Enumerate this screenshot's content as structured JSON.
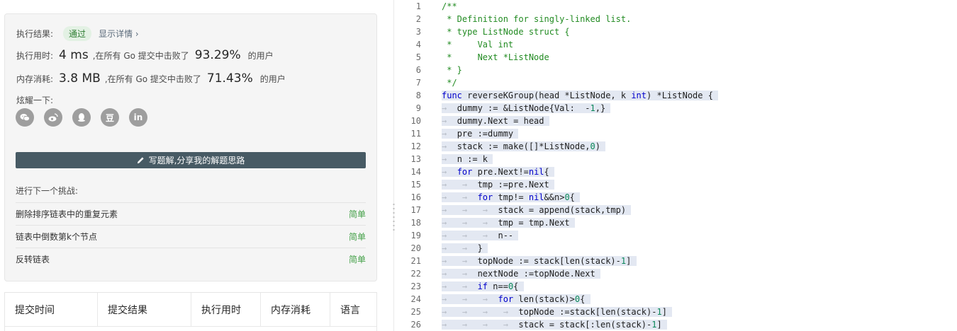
{
  "result": {
    "exec_label": "执行结果:",
    "status": "通过",
    "detail_link": "显示详情 ›",
    "time_label": "执行用时:",
    "time_value": "4 ms",
    "time_mid": ",在所有 Go 提交中击败了",
    "time_pct": "93.29%",
    "users_suffix": "的用户",
    "mem_label": "内存消耗:",
    "mem_value": "3.8 MB",
    "mem_mid": ",在所有 Go 提交中击败了",
    "mem_pct": "71.43%",
    "share_label": "炫耀一下:",
    "share_icons": [
      "wechat-icon",
      "weibo-icon",
      "qq-icon",
      "douban-icon",
      "linkedin-icon"
    ],
    "douban_glyph": "豆",
    "linkedin_glyph": "in",
    "write_button": "写题解,分享我的解题思路"
  },
  "next": {
    "title": "进行下一个挑战:",
    "items": [
      {
        "name": "删除排序链表中的重复元素",
        "difficulty": "简单"
      },
      {
        "name": "链表中倒数第k个节点",
        "difficulty": "简单"
      },
      {
        "name": "反转链表",
        "difficulty": "简单"
      }
    ]
  },
  "submissions_table": {
    "headers": [
      "提交时间",
      "提交结果",
      "执行用时",
      "内存消耗",
      "语言"
    ]
  },
  "colors": {
    "accent_dark": "#475a64",
    "success_green": "#43a047",
    "comment_green": "#228b22",
    "keyword_blue": "#0000cc",
    "highlight": "#e3e8f2"
  },
  "editor": {
    "lines": [
      [
        [
          "/**",
          "cm"
        ]
      ],
      [
        [
          " * Definition for singly-linked list.",
          "cm"
        ]
      ],
      [
        [
          " * type ListNode struct {",
          "cm"
        ]
      ],
      [
        [
          " *     Val int",
          "cm"
        ]
      ],
      [
        [
          " *     Next *ListNode",
          "cm"
        ]
      ],
      [
        [
          " * }",
          "cm"
        ]
      ],
      [
        [
          " */",
          "cm"
        ]
      ],
      [
        [
          "func",
          "kw"
        ],
        [
          " reverseKGroup(head *ListNode, k ",
          ""
        ],
        [
          "int",
          "kw"
        ],
        [
          ") *ListNode { ",
          ""
        ]
      ],
      [
        [
          "→  ",
          "ind"
        ],
        [
          "dummy := &ListNode{Val:  -",
          ""
        ],
        [
          "1",
          "num"
        ],
        [
          ",} ",
          ""
        ]
      ],
      [
        [
          "→  ",
          "ind"
        ],
        [
          "dummy.Next = head ",
          ""
        ]
      ],
      [
        [
          "→  ",
          "ind"
        ],
        [
          "pre :=dummy ",
          ""
        ]
      ],
      [
        [
          "→  ",
          "ind"
        ],
        [
          "stack := make([]*ListNode,",
          ""
        ],
        [
          "0",
          "num"
        ],
        [
          ") ",
          ""
        ]
      ],
      [
        [
          "→  ",
          "ind"
        ],
        [
          "n := k ",
          ""
        ]
      ],
      [
        [
          "→  ",
          "ind"
        ],
        [
          "for",
          "kw"
        ],
        [
          " pre.Next!=",
          ""
        ],
        [
          "nil",
          "kw"
        ],
        [
          "{ ",
          ""
        ]
      ],
      [
        [
          "→   →  ",
          "ind"
        ],
        [
          "tmp :=pre.Next ",
          ""
        ]
      ],
      [
        [
          "→   →  ",
          "ind"
        ],
        [
          "for",
          "kw"
        ],
        [
          " tmp!= ",
          ""
        ],
        [
          "nil",
          "kw"
        ],
        [
          "&&n>",
          ""
        ],
        [
          "0",
          "num"
        ],
        [
          "{ ",
          ""
        ]
      ],
      [
        [
          "→   →   →  ",
          "ind"
        ],
        [
          "stack = append(stack,tmp) ",
          ""
        ]
      ],
      [
        [
          "→   →   →  ",
          "ind"
        ],
        [
          "tmp = tmp.Next ",
          ""
        ]
      ],
      [
        [
          "→   →   →  ",
          "ind"
        ],
        [
          "n-- ",
          ""
        ]
      ],
      [
        [
          "→   →  ",
          "ind"
        ],
        [
          "} ",
          ""
        ]
      ],
      [
        [
          "→   →  ",
          "ind"
        ],
        [
          "topNode := stack[len(stack)-",
          ""
        ],
        [
          "1",
          "num"
        ],
        [
          "] ",
          ""
        ]
      ],
      [
        [
          "→   →  ",
          "ind"
        ],
        [
          "nextNode :=topNode.Next ",
          ""
        ]
      ],
      [
        [
          "→   →  ",
          "ind"
        ],
        [
          "if",
          "kw"
        ],
        [
          " n==",
          ""
        ],
        [
          "0",
          "num"
        ],
        [
          "{ ",
          ""
        ]
      ],
      [
        [
          "→   →   →  ",
          "ind"
        ],
        [
          "for",
          "kw"
        ],
        [
          " len(stack)>",
          ""
        ],
        [
          "0",
          "num"
        ],
        [
          "{ ",
          ""
        ]
      ],
      [
        [
          "→   →   →   →  ",
          "ind"
        ],
        [
          "topNode :=stack[len(stack)-",
          ""
        ],
        [
          "1",
          "num"
        ],
        [
          "] ",
          ""
        ]
      ],
      [
        [
          "→   →   →   →  ",
          "ind"
        ],
        [
          "stack = stack[:len(stack)-",
          ""
        ],
        [
          "1",
          "num"
        ],
        [
          "] ",
          ""
        ]
      ]
    ],
    "line_numbers": [
      "1",
      "2",
      "3",
      "4",
      "5",
      "6",
      "7",
      "8",
      "9",
      "10",
      "11",
      "12",
      "13",
      "14",
      "15",
      "16",
      "17",
      "18",
      "19",
      "20",
      "21",
      "22",
      "23",
      "24",
      "25",
      "26"
    ],
    "highlight_from_line": 8
  }
}
